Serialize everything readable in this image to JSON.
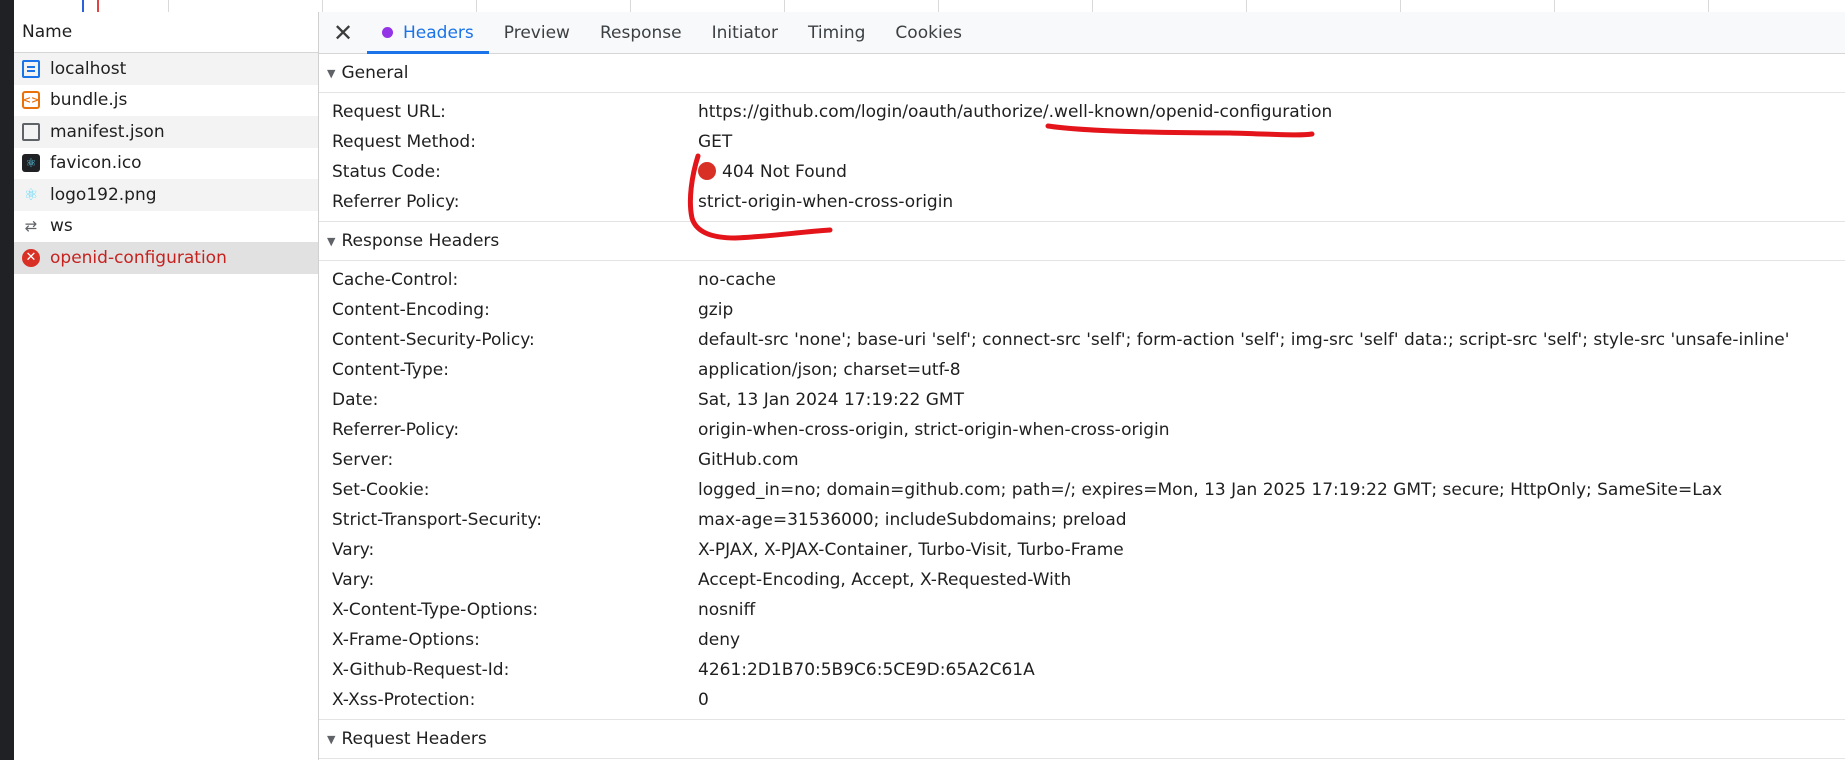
{
  "colors": {
    "accent": "#1a73e8",
    "error": "#c5221f",
    "annotation": "#e3151b",
    "headers_dot": "#9334e6"
  },
  "name_panel": {
    "header": "Name",
    "items": [
      {
        "label": "localhost",
        "icon": "document-icon"
      },
      {
        "label": "bundle.js",
        "icon": "script-icon"
      },
      {
        "label": "manifest.json",
        "icon": "file-icon"
      },
      {
        "label": "favicon.ico",
        "icon": "favicon-icon"
      },
      {
        "label": "logo192.png",
        "icon": "react-image-icon"
      },
      {
        "label": "ws",
        "icon": "websocket-icon"
      },
      {
        "label": "openid-configuration",
        "icon": "error-icon"
      }
    ]
  },
  "tabs": {
    "close_icon": "close-icon",
    "items": [
      "Headers",
      "Preview",
      "Response",
      "Initiator",
      "Timing",
      "Cookies"
    ],
    "active": "Headers"
  },
  "general": {
    "title": "General",
    "rows": [
      {
        "key": "Request URL:",
        "value": "https://github.com/login/oauth/authorize/.well-known/openid-configuration"
      },
      {
        "key": "Request Method:",
        "value": "GET"
      },
      {
        "key": "Status Code:",
        "value": "404 Not Found"
      },
      {
        "key": "Referrer Policy:",
        "value": "strict-origin-when-cross-origin"
      }
    ]
  },
  "response_headers": {
    "title": "Response Headers",
    "rows": [
      {
        "key": "Cache-Control:",
        "value": "no-cache"
      },
      {
        "key": "Content-Encoding:",
        "value": "gzip"
      },
      {
        "key": "Content-Security-Policy:",
        "value": "default-src 'none'; base-uri 'self'; connect-src 'self'; form-action 'self'; img-src 'self' data:; script-src 'self'; style-src 'unsafe-inline'"
      },
      {
        "key": "Content-Type:",
        "value": "application/json; charset=utf-8"
      },
      {
        "key": "Date:",
        "value": "Sat, 13 Jan 2024 17:19:22 GMT"
      },
      {
        "key": "Referrer-Policy:",
        "value": "origin-when-cross-origin, strict-origin-when-cross-origin"
      },
      {
        "key": "Server:",
        "value": "GitHub.com"
      },
      {
        "key": "Set-Cookie:",
        "value": "logged_in=no; domain=github.com; path=/; expires=Mon, 13 Jan 2025 17:19:22 GMT; secure; HttpOnly; SameSite=Lax"
      },
      {
        "key": "Strict-Transport-Security:",
        "value": "max-age=31536000; includeSubdomains; preload"
      },
      {
        "key": "Vary:",
        "value": "X-PJAX, X-PJAX-Container, Turbo-Visit, Turbo-Frame"
      },
      {
        "key": "Vary:",
        "value": "Accept-Encoding, Accept, X-Requested-With"
      },
      {
        "key": "X-Content-Type-Options:",
        "value": "nosniff"
      },
      {
        "key": "X-Frame-Options:",
        "value": "deny"
      },
      {
        "key": "X-Github-Request-Id:",
        "value": "4261:2D1B70:5B9C6:5CE9D:65A2C61A"
      },
      {
        "key": "X-Xss-Protection:",
        "value": "0"
      }
    ]
  },
  "request_headers": {
    "title": "Request Headers"
  }
}
